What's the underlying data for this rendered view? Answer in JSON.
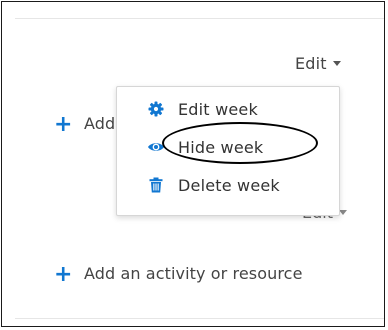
{
  "section": {
    "edit_label": "Edit",
    "add_activity_label": "Add an activity or resource",
    "next_edit_label": "Edit"
  },
  "menu": {
    "items": [
      {
        "label": "Edit week",
        "icon": "gear-icon"
      },
      {
        "label": "Hide week",
        "icon": "eye-icon"
      },
      {
        "label": "Delete week",
        "icon": "trash-icon"
      }
    ]
  },
  "colors": {
    "accent": "#1177d1",
    "annotation": "#000000"
  }
}
